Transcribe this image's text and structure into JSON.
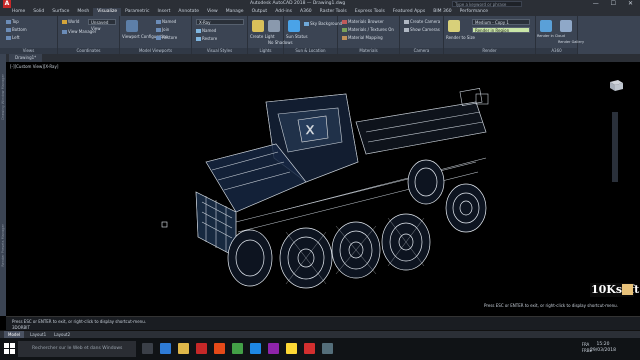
{
  "titlebar": {
    "app_letter": "A",
    "title": "Autodesk AutoCAD 2018 — Drawing1.dwg",
    "search_placeholder": "Type a keyword or phrase",
    "window_controls": "— ☐ ✕"
  },
  "tabs": [
    "Home",
    "Solid",
    "Surface",
    "Mesh",
    "Visualize",
    "Parametric",
    "Insert",
    "Annotate",
    "View",
    "Manage",
    "Output",
    "Add-ins",
    "A360",
    "Raster Tools",
    "Express Tools",
    "Featured Apps",
    "BIM 360",
    "Performance"
  ],
  "active_tab": "Visualize",
  "ribbon": {
    "views": {
      "title": "Views",
      "items": [
        "Top",
        "Bottom",
        "Left"
      ]
    },
    "coordinates": {
      "title": "Coordinates",
      "items": [
        "World",
        "View Manager",
        "Unsaved View"
      ]
    },
    "model_viewports": {
      "title": "Model Viewports",
      "items": [
        "Viewport Configuration",
        "Named",
        "Join",
        "Restore"
      ]
    },
    "visual_styles": {
      "title": "Visual Styles",
      "combo": "X-Ray",
      "items": [
        "Named",
        "Restore"
      ]
    },
    "lights": {
      "title": "Lights",
      "items": [
        "Create Light",
        "No Shadows"
      ]
    },
    "sun": {
      "title": "Sun & Location",
      "items": [
        "Sun Status",
        "Sky Background"
      ]
    },
    "materials": {
      "title": "Materials",
      "items": [
        "Materials Browser",
        "Materials / Textures On",
        "Material Mapping"
      ]
    },
    "camera": {
      "title": "Camera",
      "items": [
        "Create Camera",
        "Show Cameras"
      ]
    },
    "render": {
      "title": "Render",
      "combo": "Medium - Copy 1",
      "combo2": "Render in Region",
      "item": "Render to Size"
    },
    "a360": {
      "title": "A360",
      "items": [
        "Render in Cloud",
        "Render Gallery"
      ]
    }
  },
  "file_tab": "Drawing1*",
  "viewport_label": "[-][Custom View][X-Ray]",
  "left_labels": [
    "Drawing Window Manager",
    "Render Presets Manager"
  ],
  "cmdline": {
    "line1": "Press ESC or ENTER to exit, or right-click to display shortcut-menu.",
    "line2": "3DORBIT"
  },
  "right_cmd": "Press ESC or ENTER to exit, or right-click to display shortcut-menu.",
  "layout_tabs": [
    "Model",
    "Layout1",
    "Layout2"
  ],
  "taskbar": {
    "search_placeholder": "Rechercher sur le Web et dans Windows",
    "lang_top": "FRA",
    "lang_bot": "FRBE",
    "time": "15:20",
    "date": "29/03/2018"
  },
  "watermark": "10Ksoft"
}
